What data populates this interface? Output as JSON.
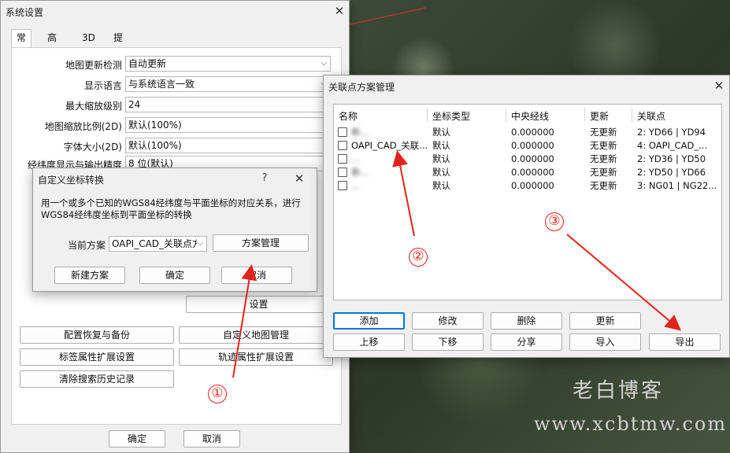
{
  "colors": {
    "accent": "#0078d7",
    "annotation": "#e2231a"
  },
  "main_window": {
    "title": "系统设置",
    "tabs": [
      {
        "label": "常用",
        "active": true
      },
      {
        "label": "高级",
        "active": false
      },
      {
        "label": "3D",
        "active": false
      },
      {
        "label": "提醒",
        "active": false
      }
    ],
    "settings": [
      {
        "label": "地图更新检测",
        "value": "自动更新"
      },
      {
        "label": "显示语言",
        "value": "与系统语言一致"
      },
      {
        "label": "最大缩放级别",
        "value": "24"
      },
      {
        "label": "地图缩放比例(2D)",
        "value": "默认(100%)"
      },
      {
        "label": "字体大小(2D)",
        "value": "默认(100%)"
      },
      {
        "label": "经纬度显示与输出精度",
        "value": "8 位(默认)"
      }
    ],
    "settings_button": "设置",
    "buttons": {
      "backup": "配置恢复与备份",
      "custom_map": "自定义地图管理",
      "label_ext": "标签属性扩展设置",
      "track_ext": "轨迹属性扩展设置",
      "clear_history": "清除搜索历史记录"
    },
    "ok": "确定",
    "cancel": "取消"
  },
  "coord_dialog": {
    "title": "自定义坐标转换",
    "help": "?",
    "description_line1": "用一个或多个已知的WGS84经纬度与平面坐标的对应关系，进行",
    "description_line2": "WGS84经纬度坐标到平面坐标的转换",
    "current_label": "当前方案",
    "current_value": "OAPI_CAD_关联点方",
    "manage_button": "方案管理",
    "new_button": "新建方案",
    "ok": "确定",
    "cancel": "取消"
  },
  "scheme_dialog": {
    "title": "关联点方案管理",
    "columns": [
      "名称",
      "坐标类型",
      "中央经线",
      "更新",
      "关联点"
    ],
    "rows": [
      {
        "name": "新...",
        "blurred": true,
        "coord_type": "默认",
        "meridian": "0.000000",
        "update": "无更新",
        "points": "2: YD66 | YD94"
      },
      {
        "name": "OAPI_CAD_关联...",
        "blurred": false,
        "coord_type": "默认",
        "meridian": "0.000000",
        "update": "无更新",
        "points": "4: OAPI_CAD_..."
      },
      {
        "name": "...",
        "blurred": true,
        "coord_type": "默认",
        "meridian": "0.000000",
        "update": "无更新",
        "points": "2: YD36 | YD50"
      },
      {
        "name": "新...",
        "blurred": true,
        "coord_type": "默认",
        "meridian": "0.000000",
        "update": "无更新",
        "points": "2: YD50 | YD66"
      },
      {
        "name": "...",
        "blurred": true,
        "coord_type": "默认",
        "meridian": "0.000000",
        "update": "无更新",
        "points": "3: NG01 | NG22..."
      }
    ],
    "buttons": {
      "add": "添加",
      "edit": "修改",
      "delete": "删除",
      "update": "更新",
      "up": "上移",
      "down": "下移",
      "share": "分享",
      "import": "导入",
      "export": "导出"
    }
  },
  "annotations": [
    "①",
    "②",
    "③"
  ],
  "watermark": {
    "line1": "老白博客",
    "line2": "www.xcbtmw.com"
  }
}
